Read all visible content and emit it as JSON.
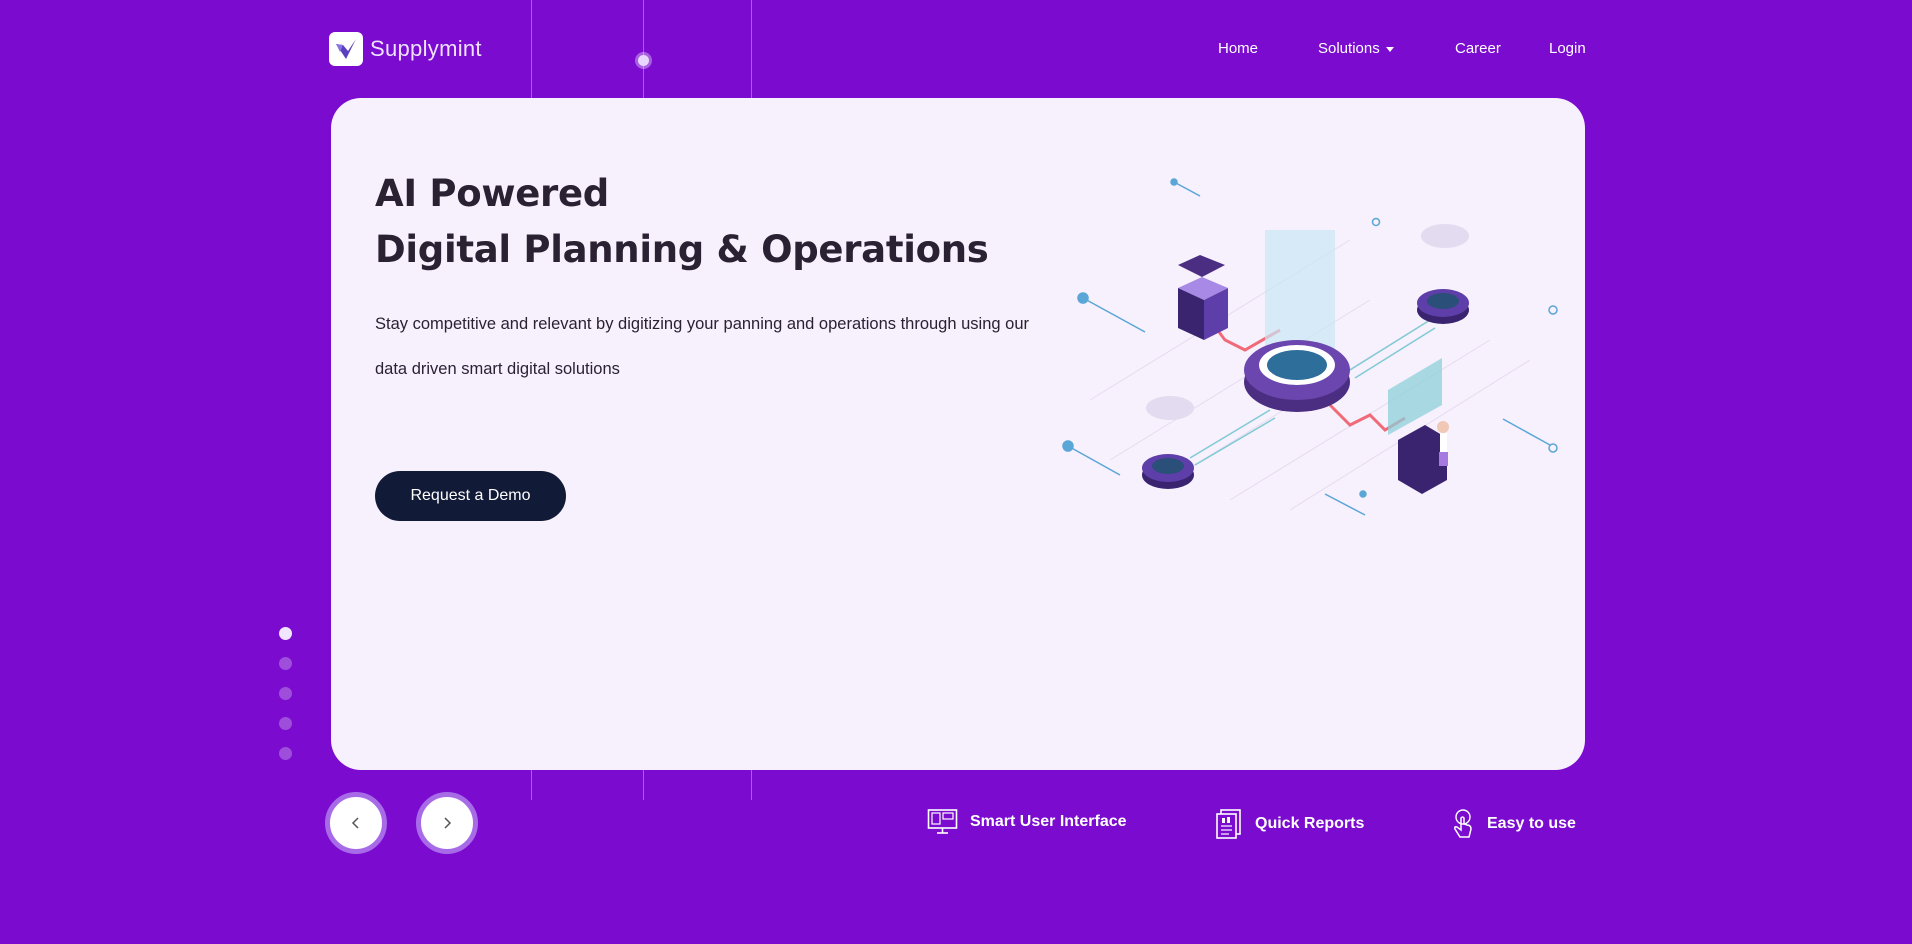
{
  "brand": {
    "name": "Supplymint"
  },
  "nav": {
    "home": "Home",
    "solutions": "Solutions",
    "career": "Career",
    "login": "Login"
  },
  "hero": {
    "title_line1": "AI Powered",
    "title_line2": "Digital Planning & Operations",
    "description": "Stay competitive and relevant by digitizing your panning and operations through using our data driven smart digital solutions",
    "cta_label": "Request a Demo"
  },
  "carousel": {
    "slide_count": 5,
    "active_index": 0,
    "prev_icon": "chevron-left-icon",
    "next_icon": "chevron-right-icon"
  },
  "features": [
    {
      "label": "Smart User Interface",
      "icon": "monitor-icon"
    },
    {
      "label": "Quick Reports",
      "icon": "report-icon"
    },
    {
      "label": "Easy to use",
      "icon": "hand-touch-icon"
    }
  ],
  "colors": {
    "background": "#7a0bcf",
    "card": "#f7f0fd",
    "cta": "#111a36",
    "heading": "#2a2233"
  }
}
